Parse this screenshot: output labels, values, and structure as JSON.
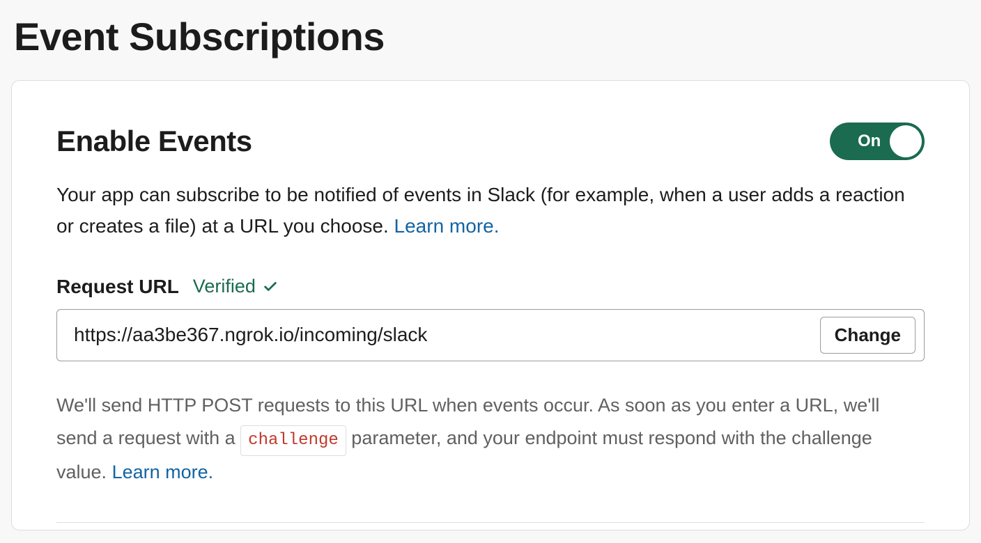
{
  "page": {
    "title": "Event Subscriptions"
  },
  "section": {
    "title": "Enable Events",
    "toggle": {
      "state_label": "On"
    },
    "description_text": "Your app can subscribe to be notified of events in Slack (for example, when a user adds a reaction or creates a file) at a URL you choose. ",
    "description_link": "Learn more."
  },
  "request_url": {
    "label": "Request URL",
    "status": "Verified",
    "value": "https://aa3be367.ngrok.io/incoming/slack",
    "change_button": "Change"
  },
  "help": {
    "text_before": "We'll send HTTP POST requests to this URL when events occur. As soon as you enter a URL, we'll send a request with a ",
    "code": "challenge",
    "text_after": " parameter, and your endpoint must respond with the challenge value. ",
    "link": "Learn more."
  }
}
